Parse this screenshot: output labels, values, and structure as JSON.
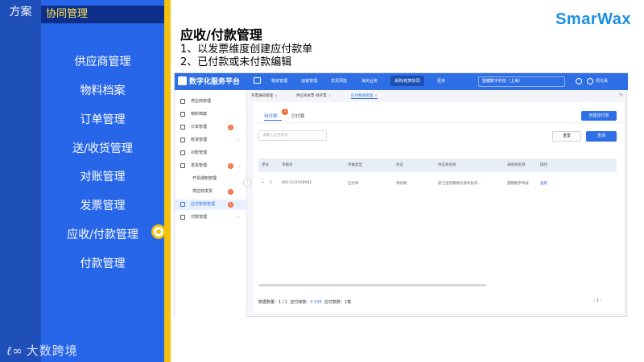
{
  "deck": {
    "tag_left": "方案",
    "tag_right": "协同管理",
    "nav_items": [
      "供应商管理",
      "物料档案",
      "订单管理",
      "送/收货管理",
      "对账管理",
      "发票管理",
      "应收/付款管理",
      "付款管理"
    ],
    "active_index": 6,
    "bottom_logo_mark": "ℓ∞",
    "bottom_logo_text": "大数跨境"
  },
  "header": {
    "title": "应收/付款管理",
    "line1": "1、以发票维度创建应付款单",
    "line2": "2、已付款或未付款编辑",
    "brand": "SmarWax"
  },
  "app": {
    "logo": "数字化服务平台",
    "top_menu": [
      "物资管理",
      "运输管理",
      "发票风险",
      "海关业务",
      "采购/结算协同",
      "更多"
    ],
    "top_menu_active": 4,
    "company": "盟糖数字科技（上海）",
    "user": "周光哥",
    "sidebar": [
      {
        "label": "供应商管理",
        "icon": "supplier-icon"
      },
      {
        "label": "物料档案",
        "icon": "material-icon"
      },
      {
        "label": "订单管理",
        "icon": "order-icon",
        "badge": "2"
      },
      {
        "label": "收货管理",
        "icon": "receipt-icon",
        "arrow": "›"
      },
      {
        "label": "对账管理",
        "icon": "reconcile-icon"
      },
      {
        "label": "发票管理",
        "icon": "invoice-icon",
        "badge": "1",
        "arrow": "⌄"
      },
      {
        "label": "开票通知管理",
        "sub": true
      },
      {
        "label": "供应商发票",
        "sub": true,
        "badge": "1"
      },
      {
        "label": "应付账款管理",
        "icon": "payable-icon",
        "badge": "1",
        "active": true
      },
      {
        "label": "付款管理",
        "icon": "payment-icon",
        "arrow": "›"
      }
    ],
    "tabs": [
      "开票通知管理",
      "供应商发票-待开票",
      "应付账款管理"
    ],
    "active_tab": 2,
    "sub_tabs": [
      "待付款",
      "已付款"
    ],
    "sub_tab_badge": "1",
    "create_button": "创建应付单",
    "search_placeholder": "请输入应付单号",
    "reset_button": "重置",
    "query_button": "查询",
    "columns": [
      "序号",
      "单据号",
      "单据类型",
      "状态",
      "供应商名称",
      "采购商名称",
      "操作"
    ],
    "rows": [
      {
        "expand": "+",
        "no": "1",
        "doc_no": "8021121000001",
        "type": "应付单",
        "status": "待付款",
        "supplier": "浙江恒凯网络信息科技有...",
        "buyer": "盟糖数字科技",
        "action": "查看"
      }
    ],
    "footer": {
      "count_label": "数据数量：",
      "count": "1 / 1",
      "payable_label": "应付账款：",
      "payable": "¥ 530",
      "paid_label": "应付款数：",
      "paid": "1笔"
    },
    "pager": "‹   1   ›"
  }
}
